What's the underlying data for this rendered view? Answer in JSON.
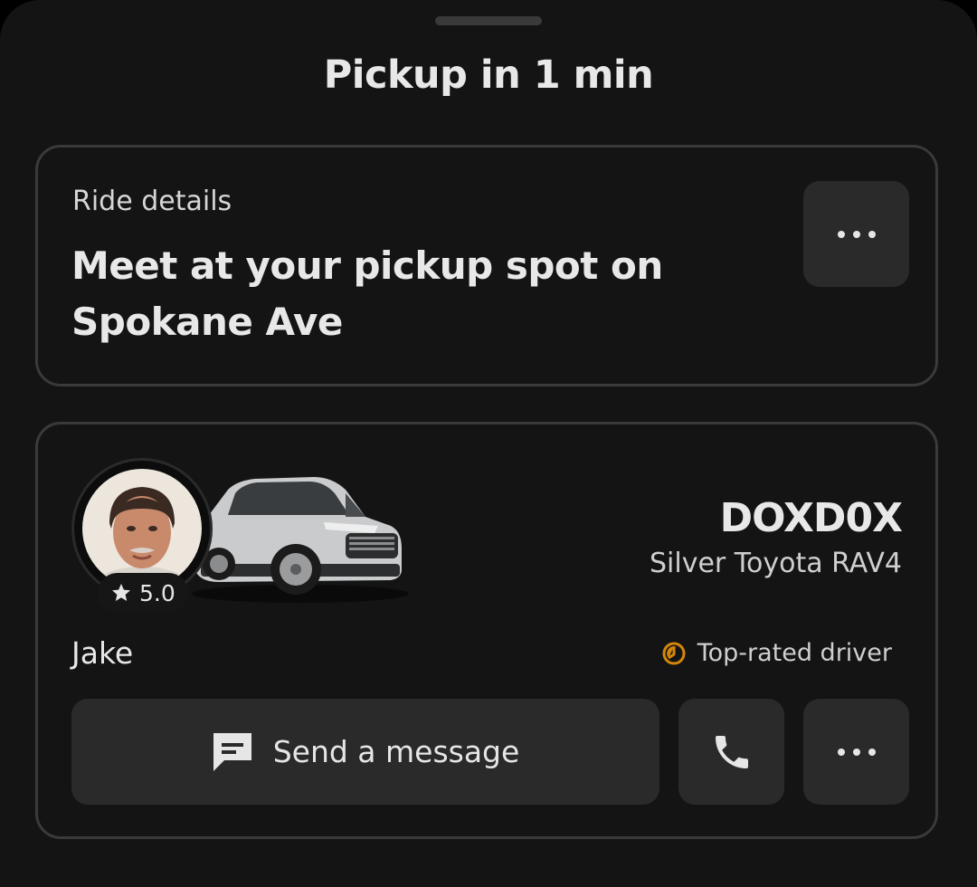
{
  "header": {
    "title": "Pickup in 1 min"
  },
  "ride_details": {
    "label": "Ride details",
    "instruction": "Meet at your pickup spot on Spokane Ave",
    "more_icon": "more-horizontal-icon"
  },
  "driver": {
    "rating": "5.0",
    "rating_icon": "star-icon",
    "name": "Jake",
    "plate": "DOXD0X",
    "vehicle": "Silver Toyota RAV4",
    "badge_icon": "top-rated-badge-icon",
    "badge_label": "Top-rated driver",
    "badge_color": "#d4860b"
  },
  "actions": {
    "message_label": "Send a message",
    "message_icon": "message-icon",
    "call_icon": "phone-icon",
    "more_icon": "more-horizontal-icon"
  }
}
